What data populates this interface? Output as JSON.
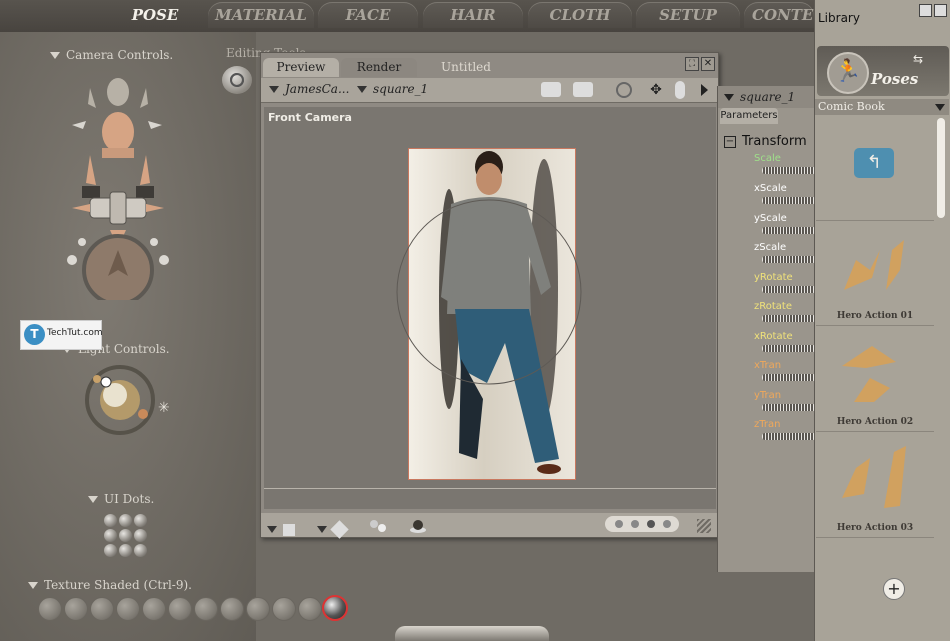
{
  "tabs": [
    {
      "label": "POSE",
      "active": true
    },
    {
      "label": "MATERIAL"
    },
    {
      "label": "FACE"
    },
    {
      "label": "HAIR"
    },
    {
      "label": "CLOTH"
    },
    {
      "label": "SETUP"
    },
    {
      "label": "CONTE"
    }
  ],
  "left_panel": {
    "camera_controls": "Camera Controls.",
    "editing_tools": "Editing Tools",
    "light_controls": "Light Controls.",
    "ui_dots": "UI Dots.",
    "texture_shaded": "Texture Shaded (Ctrl-9)."
  },
  "watermark": {
    "text": "TechTut.com"
  },
  "document": {
    "tabs": [
      "Preview",
      "Render"
    ],
    "title": "Untitled",
    "figure_select": "JamesCa...",
    "actor_select": "square_1",
    "camera_label": "Front Camera"
  },
  "params": {
    "actor": "square_1",
    "tab": "Parameters",
    "group": "Transform",
    "dials": [
      {
        "label": "Scale",
        "color": "#9fe08a"
      },
      {
        "label": "xScale",
        "color": "#ffffff"
      },
      {
        "label": "yScale",
        "color": "#ffffff"
      },
      {
        "label": "zScale",
        "color": "#ffffff"
      },
      {
        "label": "yRotate",
        "color": "#f0e27a"
      },
      {
        "label": "zRotate",
        "color": "#f0e27a"
      },
      {
        "label": "xRotate",
        "color": "#f0e27a"
      },
      {
        "label": "xTran",
        "color": "#f0a85a"
      },
      {
        "label": "yTran",
        "color": "#f0a85a"
      },
      {
        "label": "zTran",
        "color": "#f0a85a"
      }
    ]
  },
  "library": {
    "title": "Library",
    "category": "Poses",
    "subfolder": "Comic Book",
    "items": [
      "Hero Action 01",
      "Hero Action 02",
      "Hero Action 03"
    ]
  }
}
